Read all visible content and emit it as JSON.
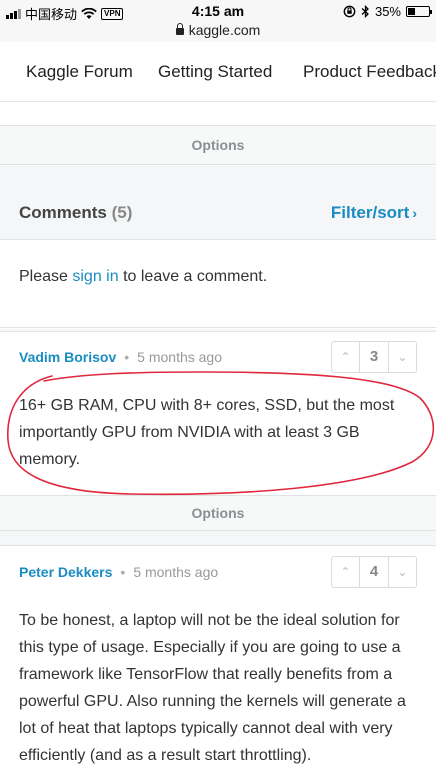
{
  "status_bar": {
    "carrier": "中国移动",
    "vpn": "VPN",
    "time": "4:15 am",
    "battery": "35%",
    "battery_level": 0.35
  },
  "browser": {
    "url": "kaggle.com"
  },
  "nav": {
    "items": [
      "Kaggle Forum",
      "Getting Started",
      "Product Feedback"
    ]
  },
  "options_label": "Options",
  "comments": {
    "title": "Comments",
    "count": "(5)",
    "filter_label": "Filter/sort",
    "signin_prefix": "Please ",
    "signin_link": "sign in",
    "signin_suffix": " to leave a comment."
  },
  "comment_list": [
    {
      "author": "Vadim Borisov",
      "time": "5 months ago",
      "votes": "3",
      "body": "16+ GB RAM, CPU with 8+ cores, SSD, but the most importantly GPU from NVIDIA with at least 3 GB memory."
    },
    {
      "author": "Peter Dekkers",
      "time": "5 months ago",
      "votes": "4",
      "body": "To be honest, a laptop will not be the ideal solution for this type of usage. Especially if you are going to use a framework like TensorFlow that really benefits from a powerful GPU. Also running the kernels will generate a lot of heat that laptops typically cannot deal with very efficiently (and as a result start throttling)."
    }
  ],
  "colors": {
    "link": "#1a8cc2",
    "annotation": "#e0283c"
  }
}
